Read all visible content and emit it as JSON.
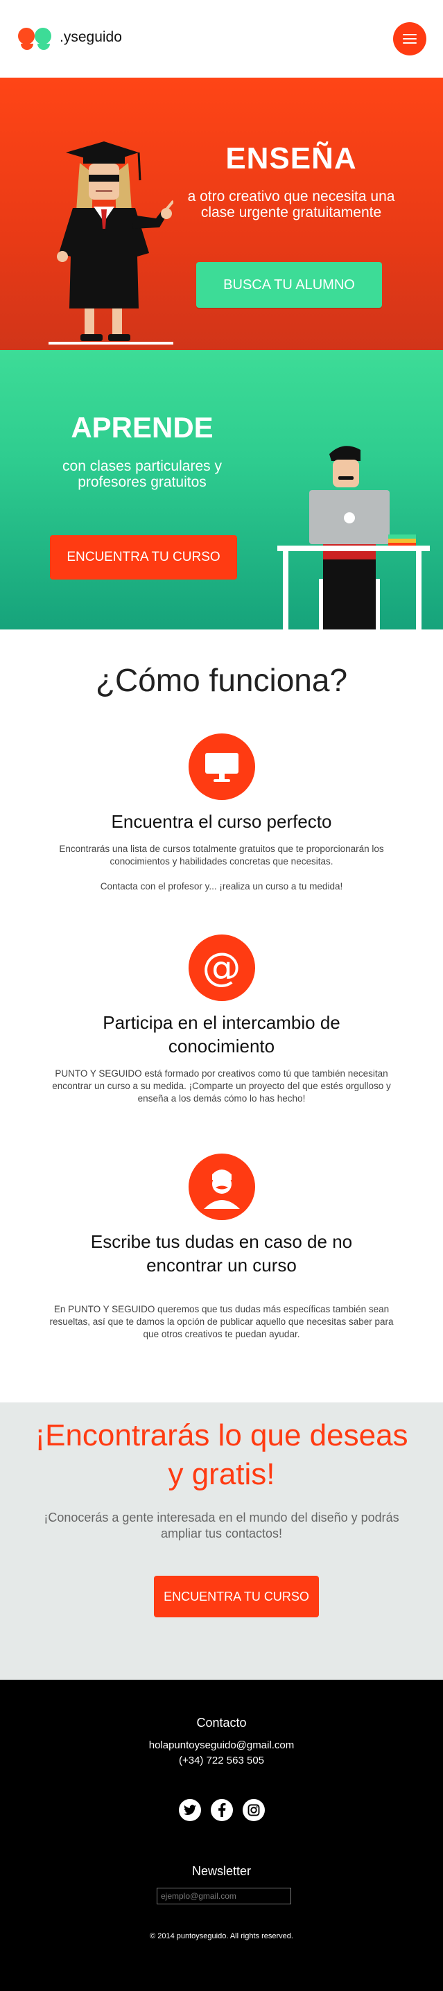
{
  "header": {
    "brand": ".yseguido",
    "menu_icon": "hamburger-icon",
    "colors": {
      "accent": "#ff3b12",
      "green": "#3ddc97"
    }
  },
  "hero_teach": {
    "title": "ENSEÑA",
    "subtitle": "a otro creativo que necesita una clase urgente gratuitamente",
    "button": "BUSCA TU ALUMNO"
  },
  "hero_learn": {
    "title": "APRENDE",
    "subtitle": "con clases particulares y profesores gratuitos",
    "button": "ENCUENTRA TU CURSO"
  },
  "how": {
    "title": "¿Cómo funciona?",
    "steps": [
      {
        "icon": "monitor-icon",
        "title": "Encuentra el curso perfecto",
        "text": "Encontrarás una lista de cursos totalmente gratuitos que te proporcionarán los conocimientos y habilidades concretas que necesitas.",
        "text2": "Contacta con el profesor y... ¡realiza un curso a tu medida!"
      },
      {
        "icon": "at-icon",
        "title": "Participa en el intercambio de conocimiento",
        "text": "PUNTO Y SEGUIDO está formado por creativos como tú que también necesitan encontrar un curso a su medida. ¡Comparte un proyecto del que estés orgulloso y enseña a los demás cómo lo has hecho!"
      },
      {
        "icon": "user-mustache-icon",
        "title": "Escribe tus dudas en caso de no encontrar un curso",
        "text": "En PUNTO Y SEGUIDO queremos que tus dudas más específicas también sean resueltas, así que te damos la opción de publicar aquello que necesitas saber para que otros creativos te puedan ayudar."
      }
    ]
  },
  "cta": {
    "title": "¡Encontrarás lo que deseas y gratis!",
    "subtitle": "¡Conocerás a gente interesada en el mundo del diseño y podrás ampliar tus contactos!",
    "button": "ENCUENTRA TU CURSO"
  },
  "footer": {
    "contact_heading": "Contacto",
    "email": "holapuntoyseguido@gmail.com",
    "phone": "(+34) 722 563 505",
    "social": [
      "twitter-icon",
      "facebook-icon",
      "instagram-icon"
    ],
    "newsletter_heading": "Newsletter",
    "newsletter_placeholder": "ejemplo@gmail.com",
    "copyright": "© 2014 puntoyseguido. All rights reserved."
  }
}
